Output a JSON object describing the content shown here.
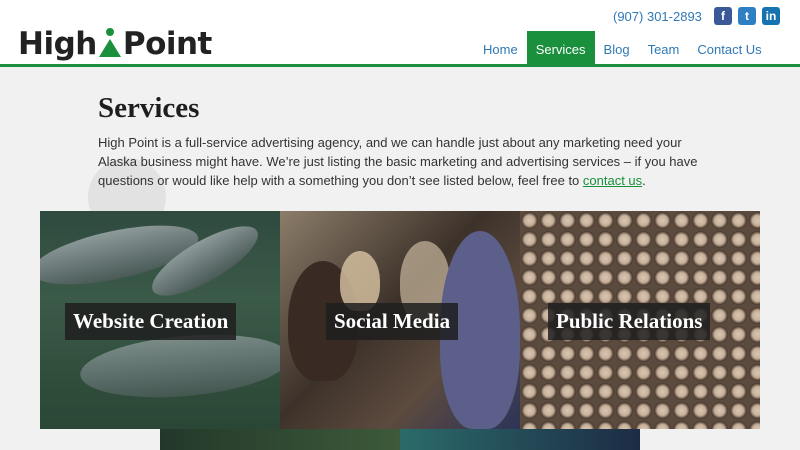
{
  "header": {
    "logo_left": "High",
    "logo_right": "Point",
    "phone": "(907) 301-2893",
    "social": [
      {
        "name": "facebook-icon",
        "glyph": "f"
      },
      {
        "name": "twitter-icon",
        "glyph": "t"
      },
      {
        "name": "linkedin-icon",
        "glyph": "in"
      }
    ],
    "nav": [
      {
        "label": "Home",
        "active": false
      },
      {
        "label": "Services",
        "active": true
      },
      {
        "label": "Blog",
        "active": false
      },
      {
        "label": "Team",
        "active": false
      },
      {
        "label": "Contact Us",
        "active": false
      }
    ]
  },
  "main": {
    "title": "Services",
    "intro_text": "High Point is a full-service advertising agency, and we can handle just about any marketing need your Alaska business might have. We’re just listing the basic marketing and advertising services – if you have questions or would like help with a something you don’t see listed below, feel free to ",
    "intro_link": "contact us",
    "intro_end": "."
  },
  "services": [
    {
      "label": "Website Creation"
    },
    {
      "label": "Social Media"
    },
    {
      "label": "Public Relations"
    }
  ],
  "colors": {
    "brand_green": "#1a8f3c",
    "link_blue": "#2f78b5",
    "page_bg": "#f1f1f1"
  }
}
